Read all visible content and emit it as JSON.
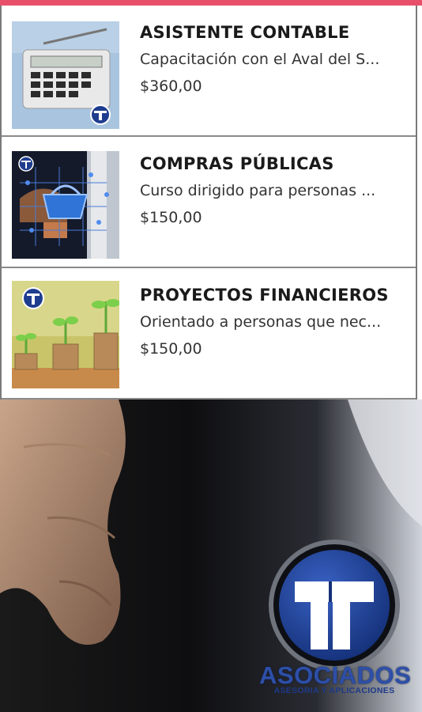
{
  "products": [
    {
      "title": "ASISTENTE CONTABLE",
      "description": "Capacitación con el Aval del S...",
      "price": "$360,00",
      "image_icon": "calculator-thumbnail"
    },
    {
      "title": "COMPRAS PÚBLICAS",
      "description": "Curso dirigido para personas ...",
      "price": "$150,00",
      "image_icon": "shopping-basket-thumbnail"
    },
    {
      "title": "PROYECTOS FINANCIEROS",
      "description": "Orientado a personas que nec...",
      "price": "$150,00",
      "image_icon": "coin-plants-thumbnail"
    }
  ],
  "banner": {
    "brand_name": "ASOCIADOS",
    "brand_tagline": "ASESORIA Y APLICACIONES"
  },
  "colors": {
    "accent_bar": "#e8506a",
    "logo_blue": "#2d4fa8"
  }
}
